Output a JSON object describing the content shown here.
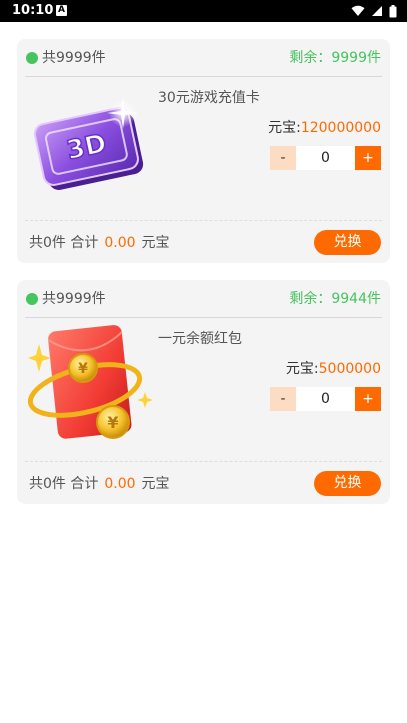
{
  "status_bar": {
    "time": "10:10",
    "notification_icon": "A",
    "icons": [
      "wifi-icon",
      "signal-icon",
      "battery-icon"
    ]
  },
  "colors": {
    "accent": "#ff6a00",
    "green": "#45c45f",
    "card_bg": "#f4f4f4"
  },
  "products": [
    {
      "total_label": "共9999件",
      "remaining_label": "剩余：9999件",
      "name": "30元游戏充值卡",
      "image": "purple-game-card-3d",
      "image_text": "3D",
      "price_label": "元宝:",
      "price_value": "120000000",
      "quantity": "0",
      "minus_label": "-",
      "plus_label": "+",
      "summary_count": "共0件",
      "summary_total_label": "合计",
      "summary_amount": "0.00",
      "summary_unit": "元宝",
      "exchange_label": "兑换"
    },
    {
      "total_label": "共9999件",
      "remaining_label": "剩余：9944件",
      "name": "一元余额红包",
      "image": "red-envelope-with-gold-coins",
      "image_text": "",
      "price_label": "元宝:",
      "price_value": "5000000",
      "quantity": "0",
      "minus_label": "-",
      "plus_label": "+",
      "summary_count": "共0件",
      "summary_total_label": "合计",
      "summary_amount": "0.00",
      "summary_unit": "元宝",
      "exchange_label": "兑换"
    }
  ]
}
